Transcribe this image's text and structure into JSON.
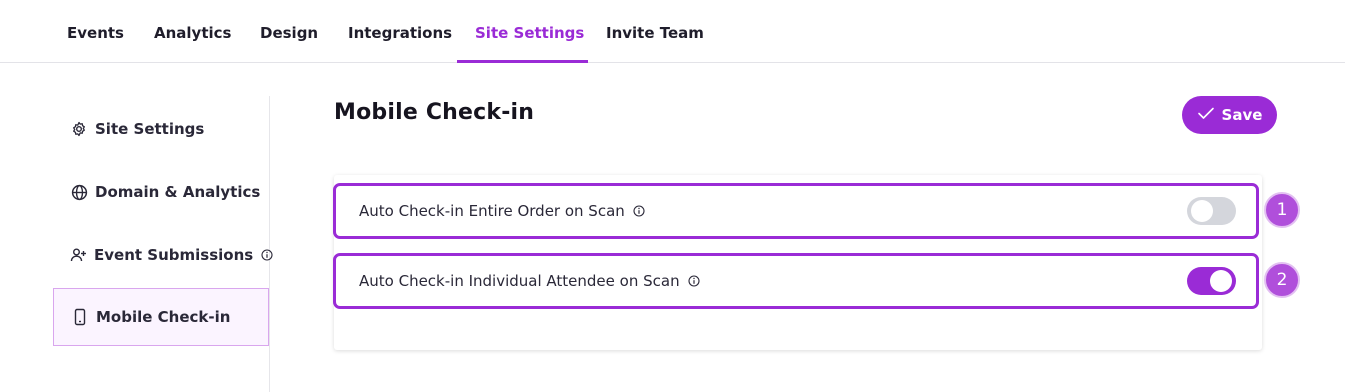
{
  "nav": {
    "tabs": [
      {
        "label": "Events"
      },
      {
        "label": "Analytics"
      },
      {
        "label": "Design"
      },
      {
        "label": "Integrations"
      },
      {
        "label": "Site Settings",
        "active": true
      },
      {
        "label": "Invite Team"
      }
    ]
  },
  "sidebar": {
    "items": [
      {
        "label": "Site Settings",
        "icon": "gear-icon"
      },
      {
        "label": "Domain & Analytics",
        "icon": "globe-icon"
      },
      {
        "label": "Event Submissions",
        "icon": "user-plus-icon",
        "has_info": true
      },
      {
        "label": "Mobile Check-in",
        "icon": "phone-icon",
        "active": true
      }
    ]
  },
  "header": {
    "title": "Mobile Check-in",
    "save_label": "Save"
  },
  "settings": [
    {
      "label": "Auto Check-in Entire Order on Scan",
      "enabled": false,
      "badge": "1"
    },
    {
      "label": "Auto Check-in Individual Attendee on Scan",
      "enabled": true,
      "badge": "2"
    }
  ],
  "colors": {
    "accent": "#9a2bd6",
    "toggle_off": "#d4d6dc",
    "badge": "#b04fdb"
  }
}
